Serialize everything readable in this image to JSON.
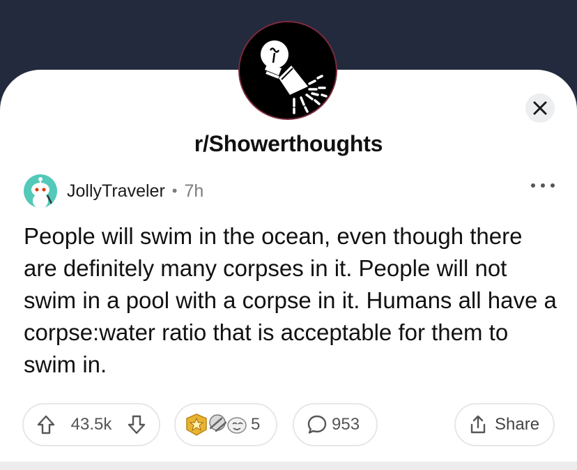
{
  "subreddit": {
    "name": "r/Showerthoughts"
  },
  "post": {
    "author": "JollyTraveler",
    "separator": "•",
    "age": "7h",
    "title": "People will swim in the ocean, even though there are definitely many corpses in it. People will not swim in a pool with a corpse in it. Humans all have a corpse:water ratio that is acceptable for them to swim in."
  },
  "actions": {
    "votes": "43.5k",
    "awards_count": "5",
    "comments": "953",
    "share_label": "Share"
  },
  "icons": {
    "close": "close-icon",
    "more": "more-dots-icon",
    "upvote": "upvote-arrow-icon",
    "downvote": "downvote-arrow-icon",
    "comment": "comment-bubble-icon",
    "share": "share-icon"
  },
  "colors": {
    "header_bg": "#232a3e",
    "card_bg": "#ffffff",
    "avatar_bg": "#52c9b9",
    "text": "#111111",
    "muted": "#7c7c7c"
  }
}
